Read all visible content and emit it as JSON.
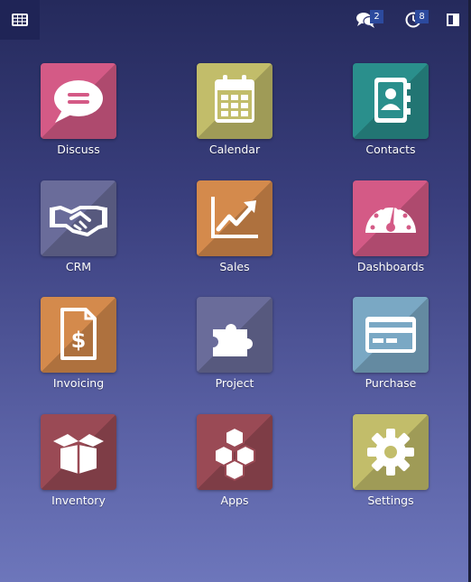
{
  "topbar": {
    "menu_icon": "grid-icon",
    "chat_icon": "chat-bubbles-icon",
    "chat_count": "2",
    "activity_icon": "clock-icon",
    "activity_count": "8",
    "panel_icon": "side-panel-icon"
  },
  "apps": [
    {
      "label": "Discuss",
      "icon": "speech-bubble-icon",
      "color": "#d45a86"
    },
    {
      "label": "Calendar",
      "icon": "calendar-icon",
      "color": "#c2bd6a"
    },
    {
      "label": "Contacts",
      "icon": "address-book-icon",
      "color": "#2a8f8c"
    },
    {
      "label": "CRM",
      "icon": "handshake-icon",
      "color": "#6a6c9a"
    },
    {
      "label": "Sales",
      "icon": "trend-chart-icon",
      "color": "#d48a4c"
    },
    {
      "label": "Dashboards",
      "icon": "gauge-icon",
      "color": "#d45a86"
    },
    {
      "label": "Invoicing",
      "icon": "invoice-dollar-icon",
      "color": "#d48a4c"
    },
    {
      "label": "Project",
      "icon": "puzzle-icon",
      "color": "#6a6c9a"
    },
    {
      "label": "Purchase",
      "icon": "credit-card-icon",
      "color": "#7aa8c4"
    },
    {
      "label": "Inventory",
      "icon": "box-icon",
      "color": "#9a4a55"
    },
    {
      "label": "Apps",
      "icon": "cubes-icon",
      "color": "#9a4a55"
    },
    {
      "label": "Settings",
      "icon": "gear-icon",
      "color": "#c2bd6a"
    }
  ]
}
